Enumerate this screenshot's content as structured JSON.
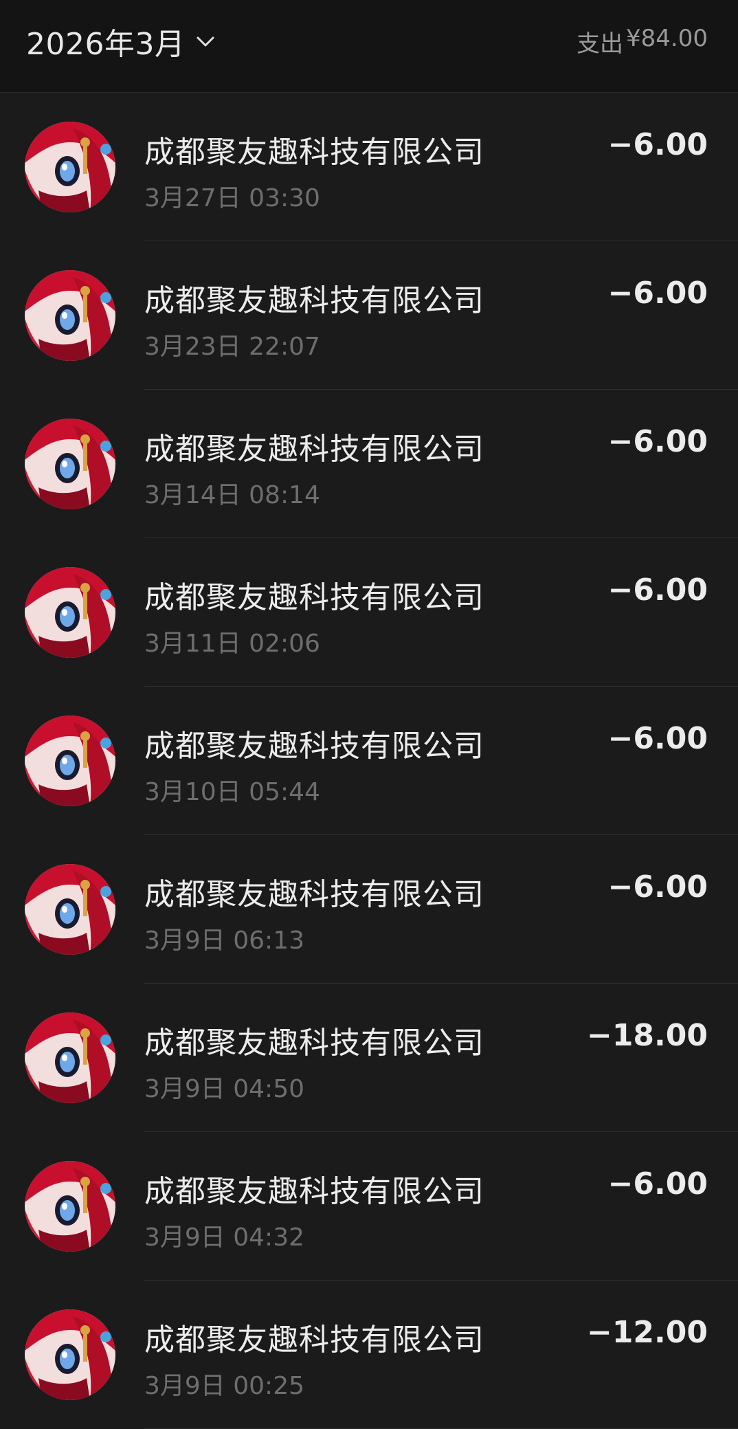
{
  "header": {
    "month": "2026年3月",
    "expense_label": "支出",
    "expense_amount": "¥84.00"
  },
  "colors": {
    "background": "#1b1b1b",
    "header_background": "#141414",
    "primary_text": "#ececec",
    "secondary_text": "#6e6e6e",
    "avatar_red": "#c8102e"
  },
  "transactions": [
    {
      "merchant": "成都聚友趣科技有限公司",
      "time": "3月27日 03:30",
      "amount": "−6.00"
    },
    {
      "merchant": "成都聚友趣科技有限公司",
      "time": "3月23日 22:07",
      "amount": "−6.00"
    },
    {
      "merchant": "成都聚友趣科技有限公司",
      "time": "3月14日 08:14",
      "amount": "−6.00"
    },
    {
      "merchant": "成都聚友趣科技有限公司",
      "time": "3月11日 02:06",
      "amount": "−6.00"
    },
    {
      "merchant": "成都聚友趣科技有限公司",
      "time": "3月10日 05:44",
      "amount": "−6.00"
    },
    {
      "merchant": "成都聚友趣科技有限公司",
      "time": "3月9日 06:13",
      "amount": "−6.00"
    },
    {
      "merchant": "成都聚友趣科技有限公司",
      "time": "3月9日 04:50",
      "amount": "−18.00"
    },
    {
      "merchant": "成都聚友趣科技有限公司",
      "time": "3月9日 04:32",
      "amount": "−6.00"
    },
    {
      "merchant": "成都聚友趣科技有限公司",
      "time": "3月9日 00:25",
      "amount": "−12.00"
    }
  ]
}
